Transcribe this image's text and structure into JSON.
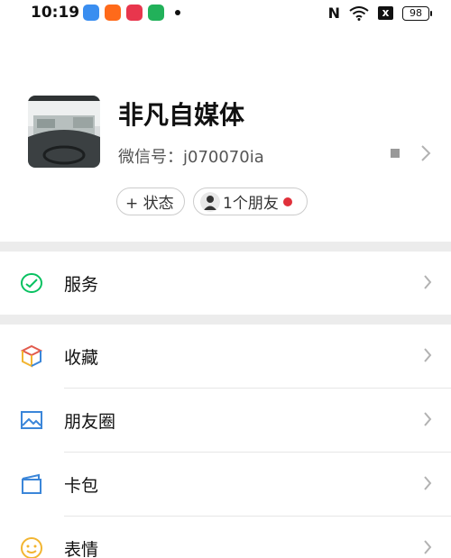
{
  "status_bar": {
    "time": "10:19",
    "battery": "98",
    "app_icons": [
      {
        "icon": "blue-app-icon",
        "color": "#3a8ef0"
      },
      {
        "icon": "taobao-icon",
        "color": "#ff6a1a"
      },
      {
        "icon": "red-app-icon",
        "color": "#e8364d"
      },
      {
        "icon": "green-app-icon",
        "color": "#22b15a"
      }
    ],
    "nfc_label": "N",
    "x_label": "x"
  },
  "profile": {
    "name": "非凡自媒体",
    "wechat_id": "微信号：j070070ia",
    "status_chip": "+ 状态",
    "friends_chip": "1个朋友"
  },
  "menu": {
    "service": "服务",
    "favorites": "收藏",
    "moments": "朋友圈",
    "cards": "卡包",
    "stickers": "表情"
  },
  "colors": {
    "wechat_green": "#07c160",
    "badge_red": "#e0303a",
    "section_gap": "#ececec"
  }
}
